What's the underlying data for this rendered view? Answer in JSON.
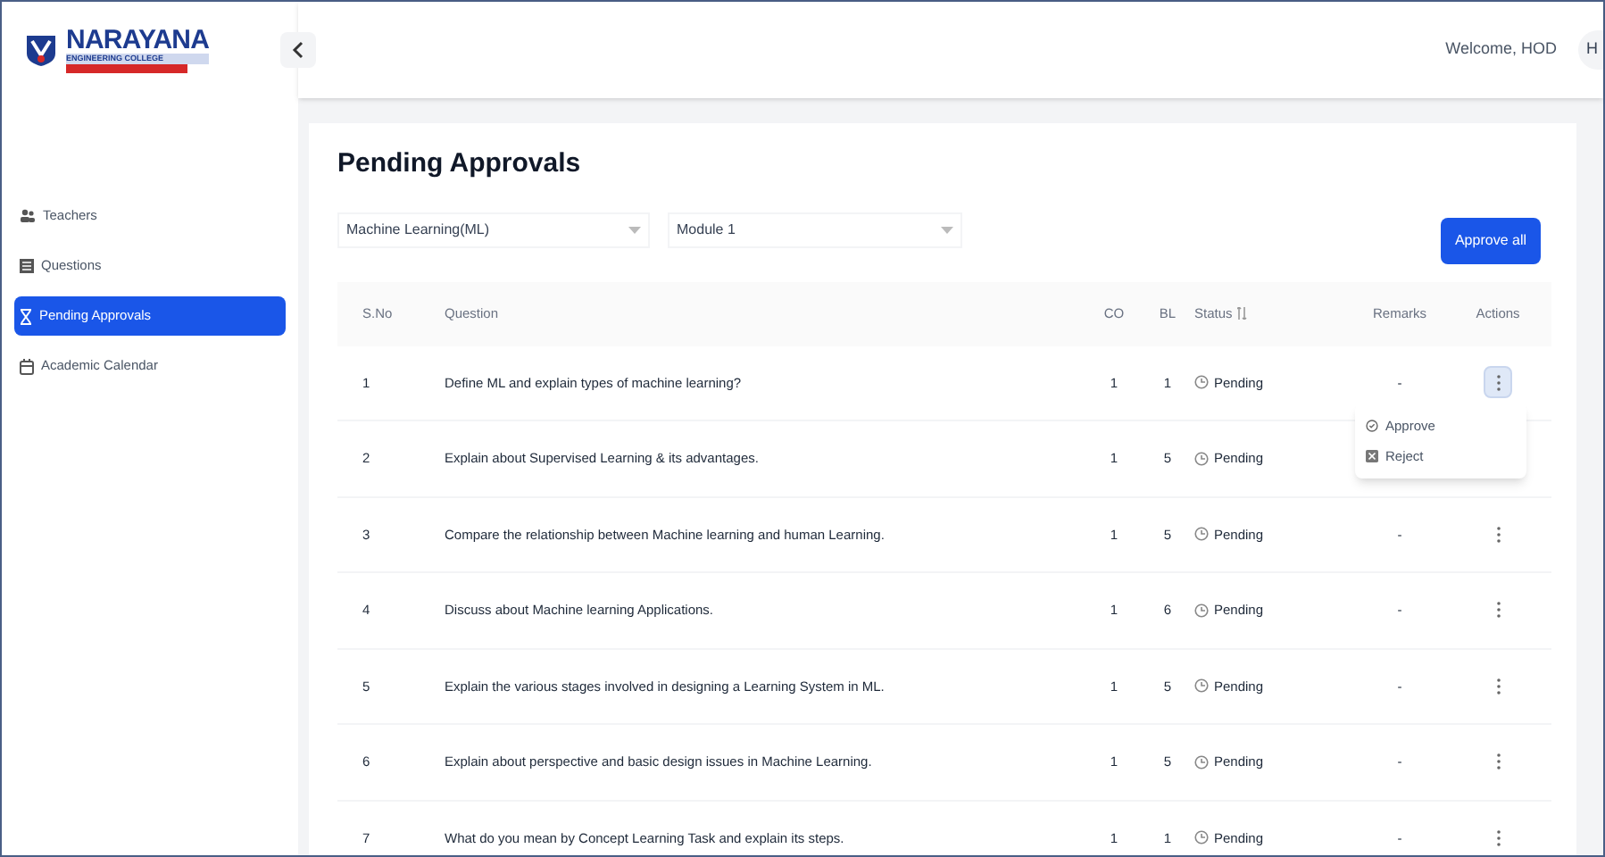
{
  "logo": {
    "name": "NARAYANA",
    "subtitle": "ENGINEERING COLLEGE"
  },
  "header": {
    "welcome": "Welcome, HOD",
    "avatar": "H"
  },
  "sidebar": {
    "items": [
      {
        "label": "Teachers",
        "selected": false
      },
      {
        "label": "Questions",
        "selected": false
      },
      {
        "label": "Pending Approvals",
        "selected": true
      },
      {
        "label": "Academic Calendar",
        "selected": false
      }
    ]
  },
  "page": {
    "title": "Pending Approvals",
    "subject_select": "Machine Learning(ML)",
    "module_select": "Module 1",
    "approve_all": "Approve all"
  },
  "table": {
    "columns": [
      "S.No",
      "Question",
      "CO",
      "BL",
      "Status",
      "Remarks",
      "Actions"
    ],
    "rows": [
      {
        "sno": "1",
        "question": "Define ML and explain types of machine learning?",
        "co": "1",
        "bl": "1",
        "status": "Pending",
        "remarks": "-",
        "actions_open": true
      },
      {
        "sno": "2",
        "question": "Explain about Supervised Learning & its advantages.",
        "co": "1",
        "bl": "5",
        "status": "Pending"
      },
      {
        "sno": "3",
        "question": "Compare the relationship between Machine learning and human Learning.",
        "co": "1",
        "bl": "5",
        "status": "Pending",
        "remarks": "-",
        "actions_open": false
      },
      {
        "sno": "4",
        "question": "Discuss about Machine learning Applications.",
        "co": "1",
        "bl": "6",
        "status": "Pending",
        "remarks": "-",
        "actions_open": false
      },
      {
        "sno": "5",
        "question": "Explain the various stages involved in designing a Learning System in ML.",
        "co": "1",
        "bl": "5",
        "status": "Pending",
        "remarks": "-",
        "actions_open": false
      },
      {
        "sno": "6",
        "question": "Explain about perspective and basic design issues in Machine Learning.",
        "co": "1",
        "bl": "5",
        "status": "Pending",
        "remarks": "-",
        "actions_open": false
      },
      {
        "sno": "7",
        "question": "What do you mean by Concept Learning Task and explain its steps.",
        "co": "1",
        "bl": "1",
        "status": "Pending",
        "remarks": "-",
        "actions_open": false
      }
    ]
  },
  "action_menu": {
    "items": [
      {
        "label": "Approve",
        "kind": "approve"
      },
      {
        "label": "Reject",
        "kind": "reject"
      }
    ]
  }
}
